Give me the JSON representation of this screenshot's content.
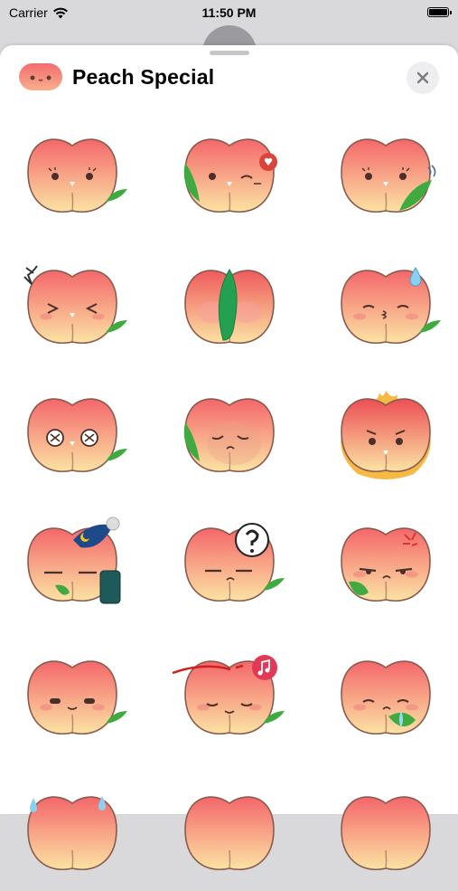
{
  "status_bar": {
    "carrier": "Carrier",
    "time": "11:50 PM"
  },
  "sheet": {
    "title": "Peach Special"
  },
  "colors": {
    "peach_top": "#f4676b",
    "peach_bottom": "#fbe3a3",
    "outline": "#8a5a4e",
    "leaf": "#3faa3f",
    "sheet_bg": "#ffffff"
  },
  "stickers": [
    {
      "name": "peach-neutral-sticker",
      "icon": "peach-smile"
    },
    {
      "name": "peach-wink-heart-sticker",
      "icon": "peach-wink-heart"
    },
    {
      "name": "peach-wave-leaf-sticker",
      "icon": "peach-wave"
    },
    {
      "name": "peach-laugh-sticker",
      "icon": "peach-laugh"
    },
    {
      "name": "peach-shy-leaf-sticker",
      "icon": "peach-shy"
    },
    {
      "name": "peach-sweat-sticker",
      "icon": "peach-sweat"
    },
    {
      "name": "peach-dizzy-sticker",
      "icon": "peach-dizzy"
    },
    {
      "name": "peach-sad-sticker",
      "icon": "peach-sad"
    },
    {
      "name": "peach-angry-fire-sticker",
      "icon": "peach-angry"
    },
    {
      "name": "peach-sleepy-sticker",
      "icon": "peach-sleepy"
    },
    {
      "name": "peach-question-sticker",
      "icon": "peach-question"
    },
    {
      "name": "peach-annoyed-sticker",
      "icon": "peach-annoyed"
    },
    {
      "name": "peach-calm-sticker",
      "icon": "peach-calm"
    },
    {
      "name": "peach-music-sticker",
      "icon": "peach-music"
    },
    {
      "name": "peach-cry-sticker",
      "icon": "peach-cry"
    },
    {
      "name": "peach-partial-sticker-1",
      "icon": "peach-partial"
    },
    {
      "name": "peach-partial-sticker-2",
      "icon": "peach-partial"
    },
    {
      "name": "peach-partial-sticker-3",
      "icon": "peach-partial"
    }
  ]
}
